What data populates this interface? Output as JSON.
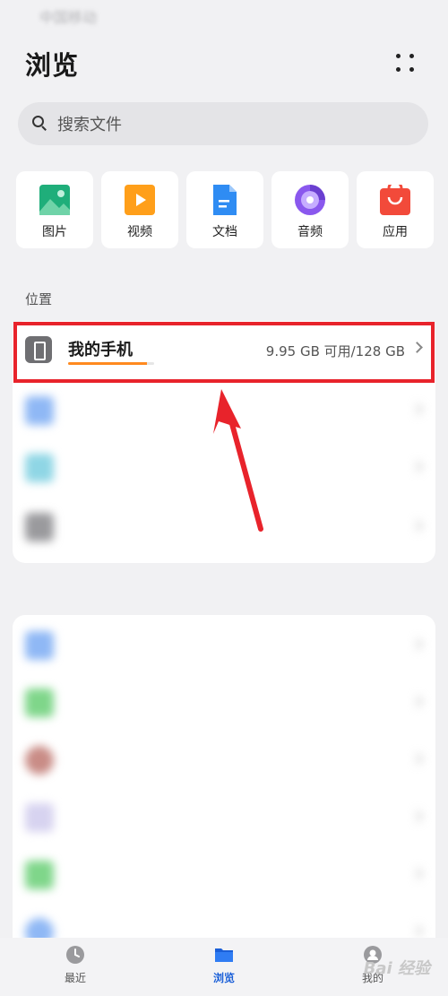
{
  "status_bar": {
    "carrier": "中国移动",
    "right": ""
  },
  "header": {
    "title": "浏览",
    "more_icon": "more-dots-icon"
  },
  "search": {
    "placeholder": "搜索文件"
  },
  "categories": [
    {
      "label": "图片",
      "icon": "image-icon",
      "color": "#1fae7a"
    },
    {
      "label": "视频",
      "icon": "video-icon",
      "color": "#ff9f1a"
    },
    {
      "label": "文档",
      "icon": "document-icon",
      "color": "#2f8cf3"
    },
    {
      "label": "音频",
      "icon": "audio-icon",
      "color": "#8a58ee"
    },
    {
      "label": "应用",
      "icon": "app-icon",
      "color": "#f24a3a"
    }
  ],
  "location": {
    "section_label": "位置",
    "phone": {
      "name": "我的手机",
      "storage": "9.95 GB 可用/128 GB",
      "used_fraction": 0.92,
      "icon": "phone-icon",
      "accent": "#ff8a1f"
    }
  },
  "highlight_color": "#e8232b",
  "bottom_nav": [
    {
      "label": "最近",
      "icon": "clock-icon"
    },
    {
      "label": "浏览",
      "icon": "folder-icon",
      "active": true
    },
    {
      "label": "我的",
      "icon": "profile-icon"
    }
  ],
  "watermark": "Bai 经验"
}
